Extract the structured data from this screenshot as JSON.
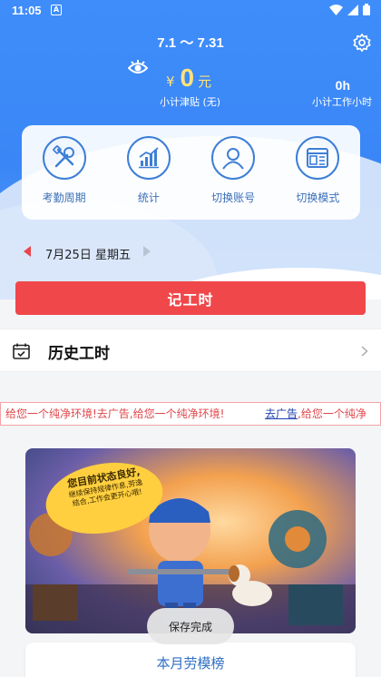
{
  "status_bar": {
    "time": "11:05",
    "badge": "A"
  },
  "header": {
    "period": "7.1 ～ 7.31",
    "amount_currency": "¥",
    "amount_value": "0",
    "amount_unit": "元",
    "amount_label": "小计津贴 (无)",
    "hours_value": "0h",
    "hours_label": "小计工作小时"
  },
  "menu": {
    "items": [
      {
        "label": "考勤周期",
        "icon": "tools-icon"
      },
      {
        "label": "统计",
        "icon": "stats-chart-icon"
      },
      {
        "label": "切换账号",
        "icon": "user-icon"
      },
      {
        "label": "切换模式",
        "icon": "layout-icon"
      }
    ]
  },
  "date_nav": {
    "date": "7月25日 星期五"
  },
  "record_button": {
    "label": "记工时"
  },
  "history": {
    "label": "历史工时"
  },
  "marquee": {
    "text_1": "给您一个纯净环境!去广告,给您一个纯净环境!",
    "link": "去广告",
    "text_2": ",给您一个纯净"
  },
  "poster": {
    "line_1": "您目前状态良好,",
    "line_2": "继续保持规律作息,劳逸",
    "line_3": "结合,工作会更开心哦!"
  },
  "toast": {
    "message": "保存完成"
  },
  "ranking": {
    "title": "本月劳模榜"
  },
  "colors": {
    "header_blue": "#3f8dfb",
    "accent_yellow": "#ffe27a",
    "record_red": "#f0474a",
    "menu_blue": "#3d7fd6",
    "link_blue": "#1e3fb0"
  }
}
